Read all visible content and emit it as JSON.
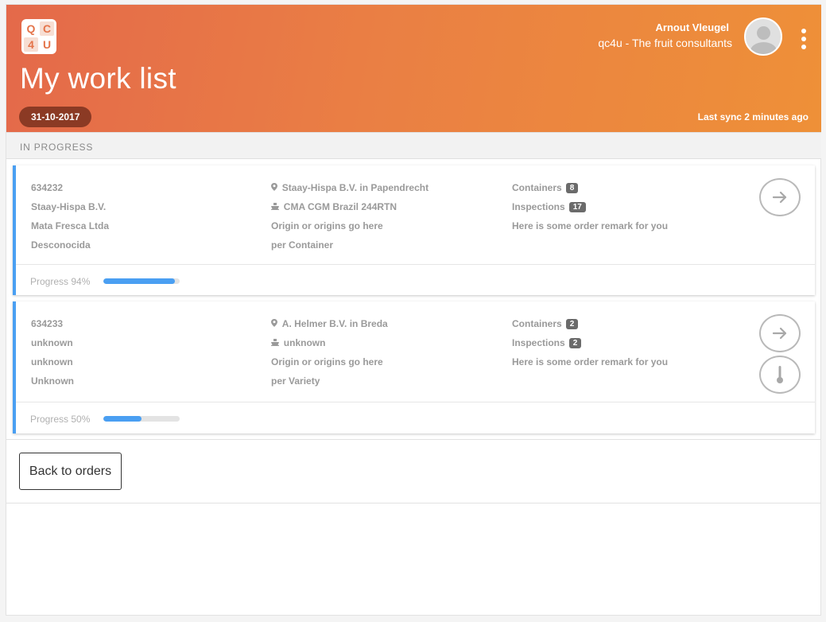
{
  "header": {
    "logo_letters": [
      "Q",
      "C",
      "4",
      "U"
    ],
    "title": "My work list",
    "user_name": "Arnout Vleugel",
    "user_org": "qc4u - The fruit consultants",
    "date": "31-10-2017",
    "sync_status": "Last sync 2 minutes ago",
    "accent_color": "#ea7f44"
  },
  "section": {
    "label": "IN PROGRESS"
  },
  "orders": [
    {
      "order_no": "634232",
      "client": "Staay-Hispa B.V.",
      "supplier": "Mata Fresca Ltda",
      "origin_name": "Desconocida",
      "location": "Staay-Hispa B.V. in Papendrecht",
      "vessel": "CMA CGM Brazil 244RTN",
      "origins_note": "Origin or origins go here",
      "inspection_mode": "per Container",
      "containers_label": "Containers",
      "containers_count": "8",
      "inspections_label": "Inspections",
      "inspections_count": "17",
      "remark": "Here is some order remark for you",
      "progress_text": "Progress 94%",
      "progress": 94
    },
    {
      "order_no": "634233",
      "client": "unknown",
      "supplier": "unknown",
      "origin_name": "Unknown",
      "location": "A. Helmer B.V. in Breda",
      "vessel": "unknown",
      "origins_note": "Origin or origins go here",
      "inspection_mode": "per Variety",
      "containers_label": "Containers",
      "containers_count": "2",
      "inspections_label": "Inspections",
      "inspections_count": "2",
      "remark": "Here is some order remark for you",
      "progress_text": "Progress 50%",
      "progress": 50
    }
  ],
  "actions": {
    "back_label": "Back to orders"
  },
  "icons": {
    "location": "map-pin-icon",
    "vessel": "ship-icon",
    "open": "arrow-right-circle-icon",
    "temperature": "thermometer-icon",
    "menu": "more-vertical-icon"
  },
  "colors": {
    "progress": "#4a9ff2",
    "date_chip": "#8b3a24"
  }
}
